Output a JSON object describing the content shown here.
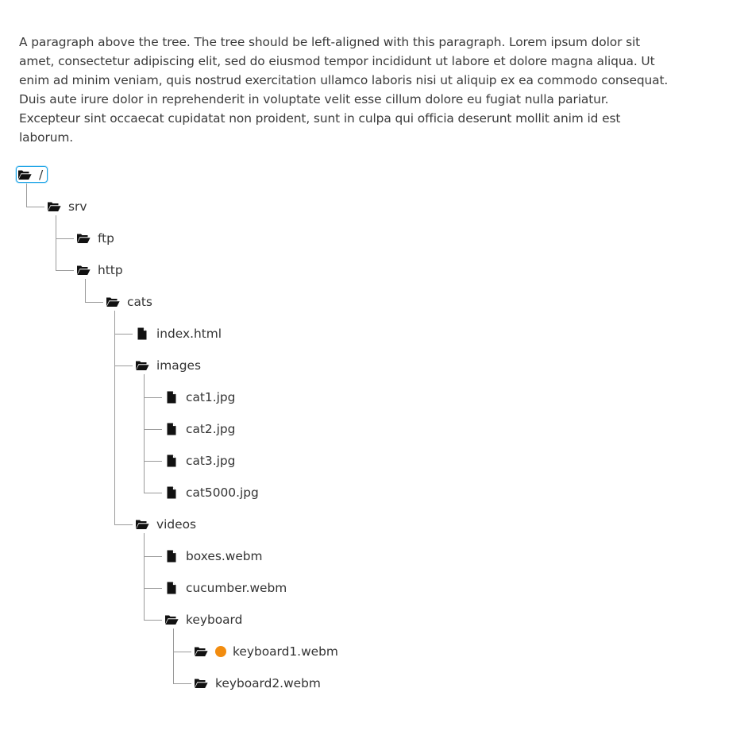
{
  "paragraph": "A paragraph above the tree. The tree should be left-aligned with this paragraph. Lorem ipsum dolor sit amet, consectetur adipiscing elit, sed do eiusmod tempor incididunt ut labore et dolore magna aliqua. Ut enim ad minim veniam, quis nostrud exercitation ullamco laboris nisi ut aliquip ex ea commodo consequat. Duis aute irure dolor in reprehenderit in voluptate velit esse cillum dolore eu fugiat nulla pariatur. Excepteur sint occaecat cupidatat non proident, sunt in culpa qui officia deserunt mollit anim id est laborum.",
  "colors": {
    "focus": "#1aa3e6",
    "connector": "#9a9a9a",
    "status_dot": "#f28c0f"
  },
  "tree": {
    "label": "/",
    "type": "folder",
    "focused": true,
    "children": [
      {
        "label": "srv",
        "type": "folder",
        "children": [
          {
            "label": "ftp",
            "type": "folder",
            "children": []
          },
          {
            "label": "http",
            "type": "folder",
            "children": [
              {
                "label": "cats",
                "type": "folder",
                "children": [
                  {
                    "label": "index.html",
                    "type": "file"
                  },
                  {
                    "label": "images",
                    "type": "folder",
                    "children": [
                      {
                        "label": "cat1.jpg",
                        "type": "file"
                      },
                      {
                        "label": "cat2.jpg",
                        "type": "file"
                      },
                      {
                        "label": "cat3.jpg",
                        "type": "file"
                      },
                      {
                        "label": "cat5000.jpg",
                        "type": "file"
                      }
                    ]
                  },
                  {
                    "label": "videos",
                    "type": "folder",
                    "children": [
                      {
                        "label": "boxes.webm",
                        "type": "file"
                      },
                      {
                        "label": "cucumber.webm",
                        "type": "file"
                      },
                      {
                        "label": "keyboard",
                        "type": "folder",
                        "children": [
                          {
                            "label": "keyboard1.webm",
                            "type": "folder",
                            "status_dot": true,
                            "children": []
                          },
                          {
                            "label": "keyboard2.webm",
                            "type": "folder",
                            "children": []
                          }
                        ]
                      }
                    ]
                  }
                ]
              }
            ]
          }
        ]
      }
    ]
  }
}
